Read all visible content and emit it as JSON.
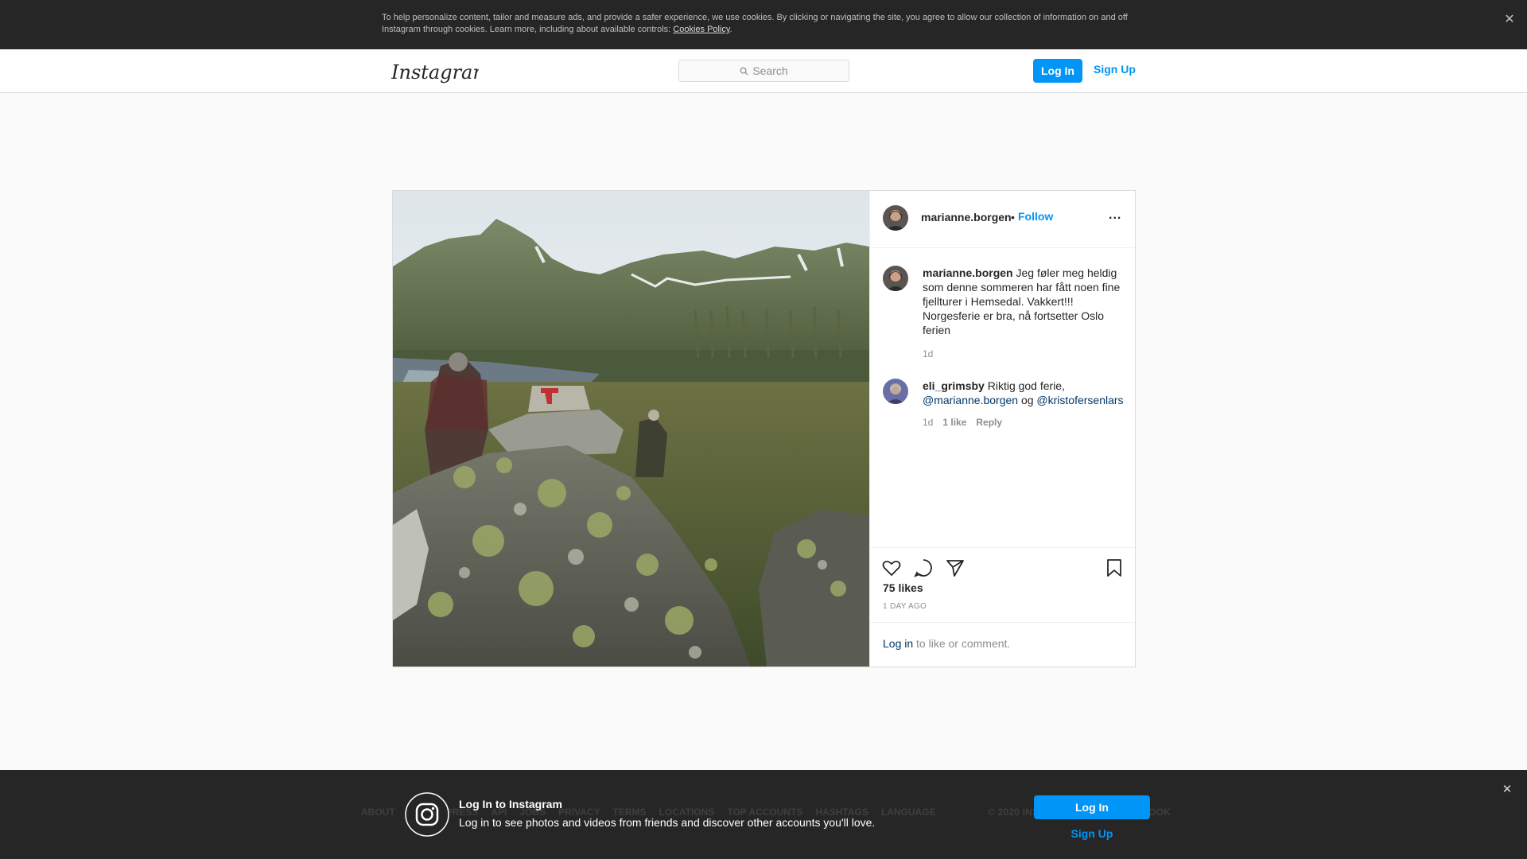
{
  "cookie_banner": {
    "text": "To help personalize content, tailor and measure ads, and provide a safer experience, we use cookies. By clicking or navigating the site, you agree to allow our collection of information on and off Instagram through cookies. Learn more, including about available controls: ",
    "link": "Cookies Policy",
    "end": ".",
    "close_icon": "close-icon"
  },
  "header": {
    "logo_text": "Instagram",
    "search_placeholder": "Search",
    "login": "Log In",
    "signup": "Sign Up"
  },
  "post": {
    "author": "marianne.borgen",
    "dot": "•",
    "follow": "Follow",
    "more": "...",
    "comments": [
      {
        "user": "marianne.borgen",
        "text": " Jeg føler meg heldig som denne sommeren har fått noen fine fjellturer i Hemsedal. Vakkert!!! Norgesferie er bra, nå fortsetter Oslo ferien",
        "time": "1d"
      },
      {
        "user": "eli_grimsby",
        "text_a": " Riktig god ferie, ",
        "mention_1": "@marianne.borgen",
        "text_b": " og ",
        "mention_2": "@kristofersenlars",
        "time": "1d",
        "likes": "1 like",
        "reply": "Reply"
      }
    ],
    "likes": "75 likes",
    "ago": "1 DAY AGO",
    "login_link": "Log in",
    "login_rest": " to like or comment."
  },
  "footer": {
    "links": [
      "ABOUT",
      "HELP",
      "PRESS",
      "API",
      "JOBS",
      "PRIVACY",
      "TERMS",
      "LOCATIONS",
      "TOP ACCOUNTS",
      "HASHTAGS",
      "LANGUAGE"
    ],
    "copyright": "© 2020 INSTAGRAM FROM FACEBOOK"
  },
  "login_bar": {
    "title": "Log In to Instagram",
    "desc": "Log in to see photos and videos from friends and discover other accounts you'll love.",
    "login": "Log In",
    "signup": "Sign Up"
  },
  "colors": {
    "accent": "#0095f6",
    "link_dark": "#00376b",
    "banner_bg": "#262626"
  }
}
